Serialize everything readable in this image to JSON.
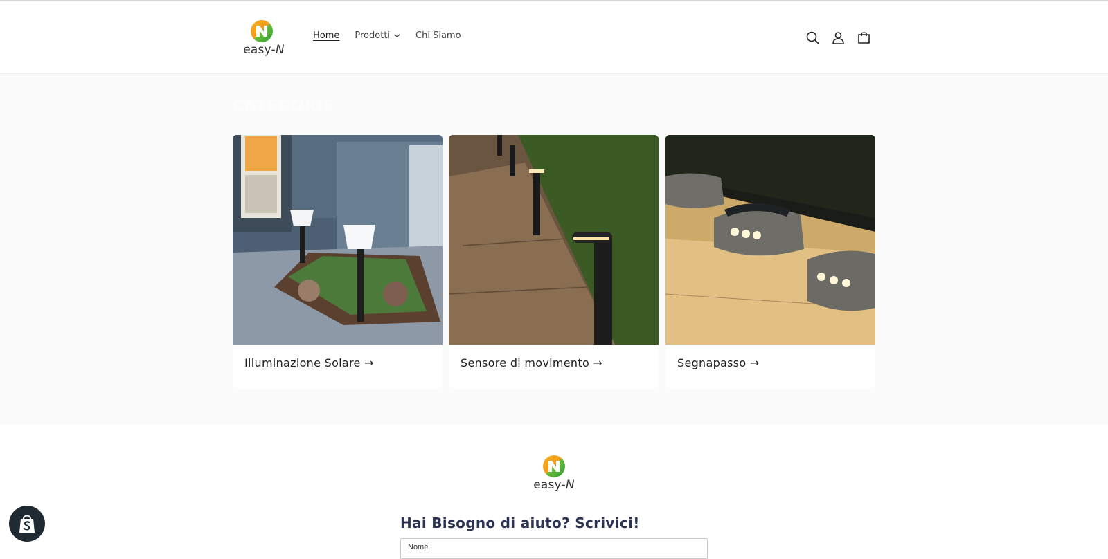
{
  "header": {
    "logo_text_main": "easy-",
    "logo_text_n": "N",
    "nav": [
      {
        "label": "Home"
      },
      {
        "label": "Prodotti"
      },
      {
        "label": "Chi Siamo"
      }
    ],
    "icons": [
      "search-icon",
      "account-icon",
      "cart-icon"
    ]
  },
  "collections": {
    "title": "CATEGORIE",
    "cards": [
      {
        "label": "Illuminazione Solare →"
      },
      {
        "label": "Sensore di movimento →"
      },
      {
        "label": "Segnapasso →"
      }
    ]
  },
  "contact": {
    "logo_text_main": "easy-",
    "logo_text_n": "N",
    "title": "Hai Bisogno di aiuto? Scrivici!",
    "name_label": "Nome"
  },
  "colors": {
    "accent_green": "#35a235",
    "accent_orange": "#f39a1e",
    "heading_navy": "#2b3354"
  }
}
